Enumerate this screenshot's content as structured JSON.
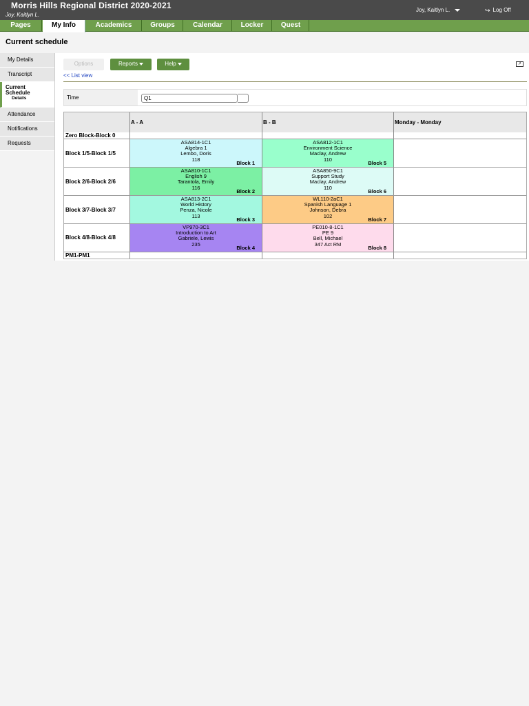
{
  "header": {
    "district": "Morris Hills Regional District 2020-2021",
    "user_sub": "Joy, Kaitlyn L.",
    "user_menu": "Joy, Kaitlyn L.",
    "logoff": "Log Off"
  },
  "tabs": [
    "Pages",
    "My Info",
    "Academics",
    "Groups",
    "Calendar",
    "Locker",
    "Quest"
  ],
  "page_title": "Current schedule",
  "sidebar": {
    "items": [
      "My Details",
      "Transcript"
    ],
    "active_line1": "Current",
    "active_line2": "Schedule",
    "active_sub": "Details",
    "items_after": [
      "Attendance",
      "Notifications",
      "Requests"
    ]
  },
  "toolbar": {
    "options": "Options",
    "reports": "Reports",
    "help": "Help",
    "list_view": "<< List view"
  },
  "filter": {
    "label": "Time",
    "value": "Q1"
  },
  "grid": {
    "headers": [
      "A - A",
      "B - B",
      "Monday - Monday"
    ],
    "rows": [
      "Zero Block-Block 0",
      "Block 1/5-Block 1/5",
      "Block 2/6-Block 2/6",
      "Block 3/7-Block 3/7",
      "Block 4/8-Block 4/8",
      "PM1-PM1"
    ],
    "classes": [
      {
        "code": "ASA814-1C1",
        "course": "Algebra 1",
        "teacher": "Lembo, Doris",
        "room": "118",
        "block": "Block 1",
        "color": "#ccf7fb"
      },
      {
        "code": "ASA812-1C1",
        "course": "Environment Science",
        "teacher": "Maclay, Andrew",
        "room": "110",
        "block": "Block 5",
        "color": "#99ffcc"
      },
      {
        "code": "ASA810-1C1",
        "course": "English 9",
        "teacher": "Tarantola, Emily",
        "room": "116",
        "block": "Block 2",
        "color": "#7cf0a4"
      },
      {
        "code": "ASA850-9C1",
        "course": "Support Study",
        "teacher": "Maclay, Andrew",
        "room": "110",
        "block": "Block 6",
        "color": "#ddfbf6"
      },
      {
        "code": "ASA813-2C1",
        "course": "World History",
        "teacher": "Penza, Nicole",
        "room": "113",
        "block": "Block 3",
        "color": "#a3f8e0"
      },
      {
        "code": "WL110-2aC1",
        "course": "Spanish Language 1",
        "teacher": "Johnson, Debra",
        "room": "102",
        "block": "Block 7",
        "color": "#fdcb86"
      },
      {
        "code": "VP970-3C1",
        "course": "Introduction to Art",
        "teacher": "Gabriele, Lewis",
        "room": "235",
        "block": "Block 4",
        "color": "#a685f2"
      },
      {
        "code": "PE010-8-1C1",
        "course": "PE 9",
        "teacher": "Bell, Michael",
        "room": "347 Act RM",
        "block": "Block 8",
        "color": "#fedbec"
      }
    ]
  },
  "colors": {
    "tab_green": "#6f9f4c",
    "header_gray": "#4a4a4a",
    "link_blue": "#1a3fbf"
  }
}
